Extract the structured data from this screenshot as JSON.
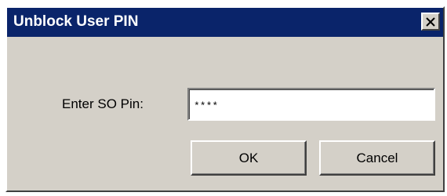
{
  "window": {
    "title": "Unblock User PIN",
    "close_icon": "close-icon"
  },
  "form": {
    "pin_label": "Enter SO Pin:",
    "pin_value": "****"
  },
  "buttons": {
    "ok_label": "OK",
    "cancel_label": "Cancel"
  },
  "colors": {
    "titlebar": "#0a246a",
    "dialog_face": "#d4d0c8",
    "title_text": "#ffffff"
  }
}
